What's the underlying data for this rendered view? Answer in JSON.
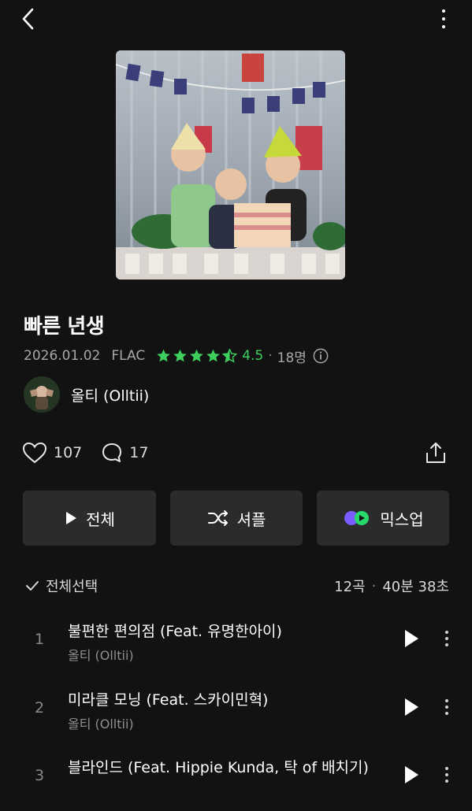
{
  "album": {
    "title": "빠른 년생",
    "date": "2026.01.02",
    "format": "FLAC",
    "rating": "4.5",
    "rating_value": 4.5,
    "rating_count": "18명"
  },
  "artist": {
    "name": "올티 (Olltii)"
  },
  "social": {
    "likes": "107",
    "comments": "17"
  },
  "actions": {
    "play_all": "전체",
    "shuffle": "셔플",
    "mixup": "믹스업"
  },
  "tracklist": {
    "select_all": "전체선택",
    "count": "12곡",
    "duration": "40분 38초",
    "tracks": [
      {
        "num": "1",
        "title": "불편한 편의점 (Feat. 유명한아이)",
        "artist": "올티 (Olltii)"
      },
      {
        "num": "2",
        "title": "미라클 모닝 (Feat. 스카이민혁)",
        "artist": "올티 (Olltii)"
      },
      {
        "num": "3",
        "title": "블라인드 (Feat. Hippie Kunda, 탁 of 배치기)",
        "artist": ""
      }
    ]
  },
  "colors": {
    "accent": "#3ed05e",
    "background": "#121212",
    "button": "#2b2b2b"
  },
  "icons": [
    "back-arrow-icon",
    "more-vertical-icon",
    "star-icon",
    "info-icon",
    "heart-icon",
    "comment-icon",
    "share-icon",
    "play-icon",
    "shuffle-icon",
    "mixup-icon",
    "checkmark-icon"
  ]
}
